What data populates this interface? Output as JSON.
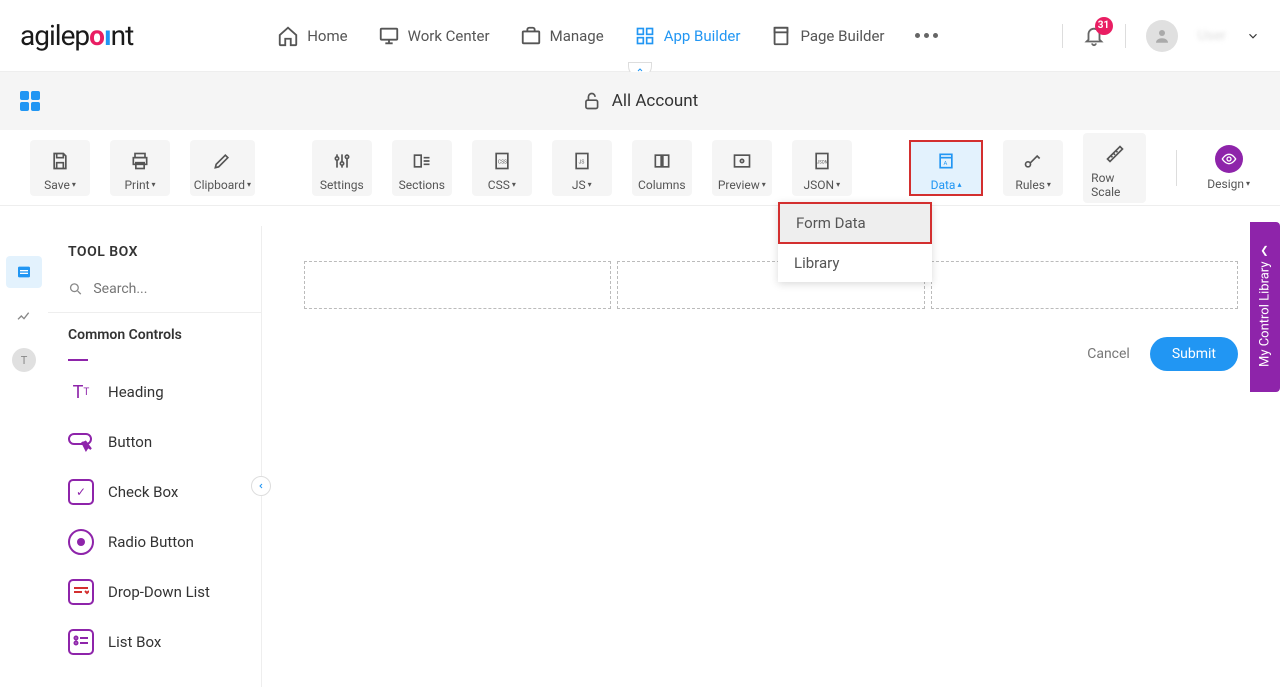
{
  "header": {
    "logo_text": "agilepoint",
    "nav": {
      "home": "Home",
      "work_center": "Work Center",
      "manage": "Manage",
      "app_builder": "App Builder",
      "page_builder": "Page Builder"
    },
    "notification_count": "31",
    "username": "User"
  },
  "title_bar": {
    "title": "All Account"
  },
  "toolbar": {
    "save": "Save",
    "print": "Print",
    "clipboard": "Clipboard",
    "settings": "Settings",
    "sections": "Sections",
    "css": "CSS",
    "js": "JS",
    "columns": "Columns",
    "preview": "Preview",
    "json": "JSON",
    "data": "Data",
    "rules": "Rules",
    "row_scale": "Row Scale",
    "design": "Design"
  },
  "data_dropdown": {
    "form_data": "Form Data",
    "library": "Library"
  },
  "toolbox": {
    "title": "TOOL BOX",
    "search_placeholder": "Search...",
    "section": "Common Controls",
    "items": {
      "heading": "Heading",
      "button": "Button",
      "checkbox": "Check Box",
      "radio": "Radio Button",
      "dropdown": "Drop-Down List",
      "listbox": "List Box"
    }
  },
  "form": {
    "cancel": "Cancel",
    "submit": "Submit"
  },
  "side_panel": {
    "label": "My Control Library"
  }
}
